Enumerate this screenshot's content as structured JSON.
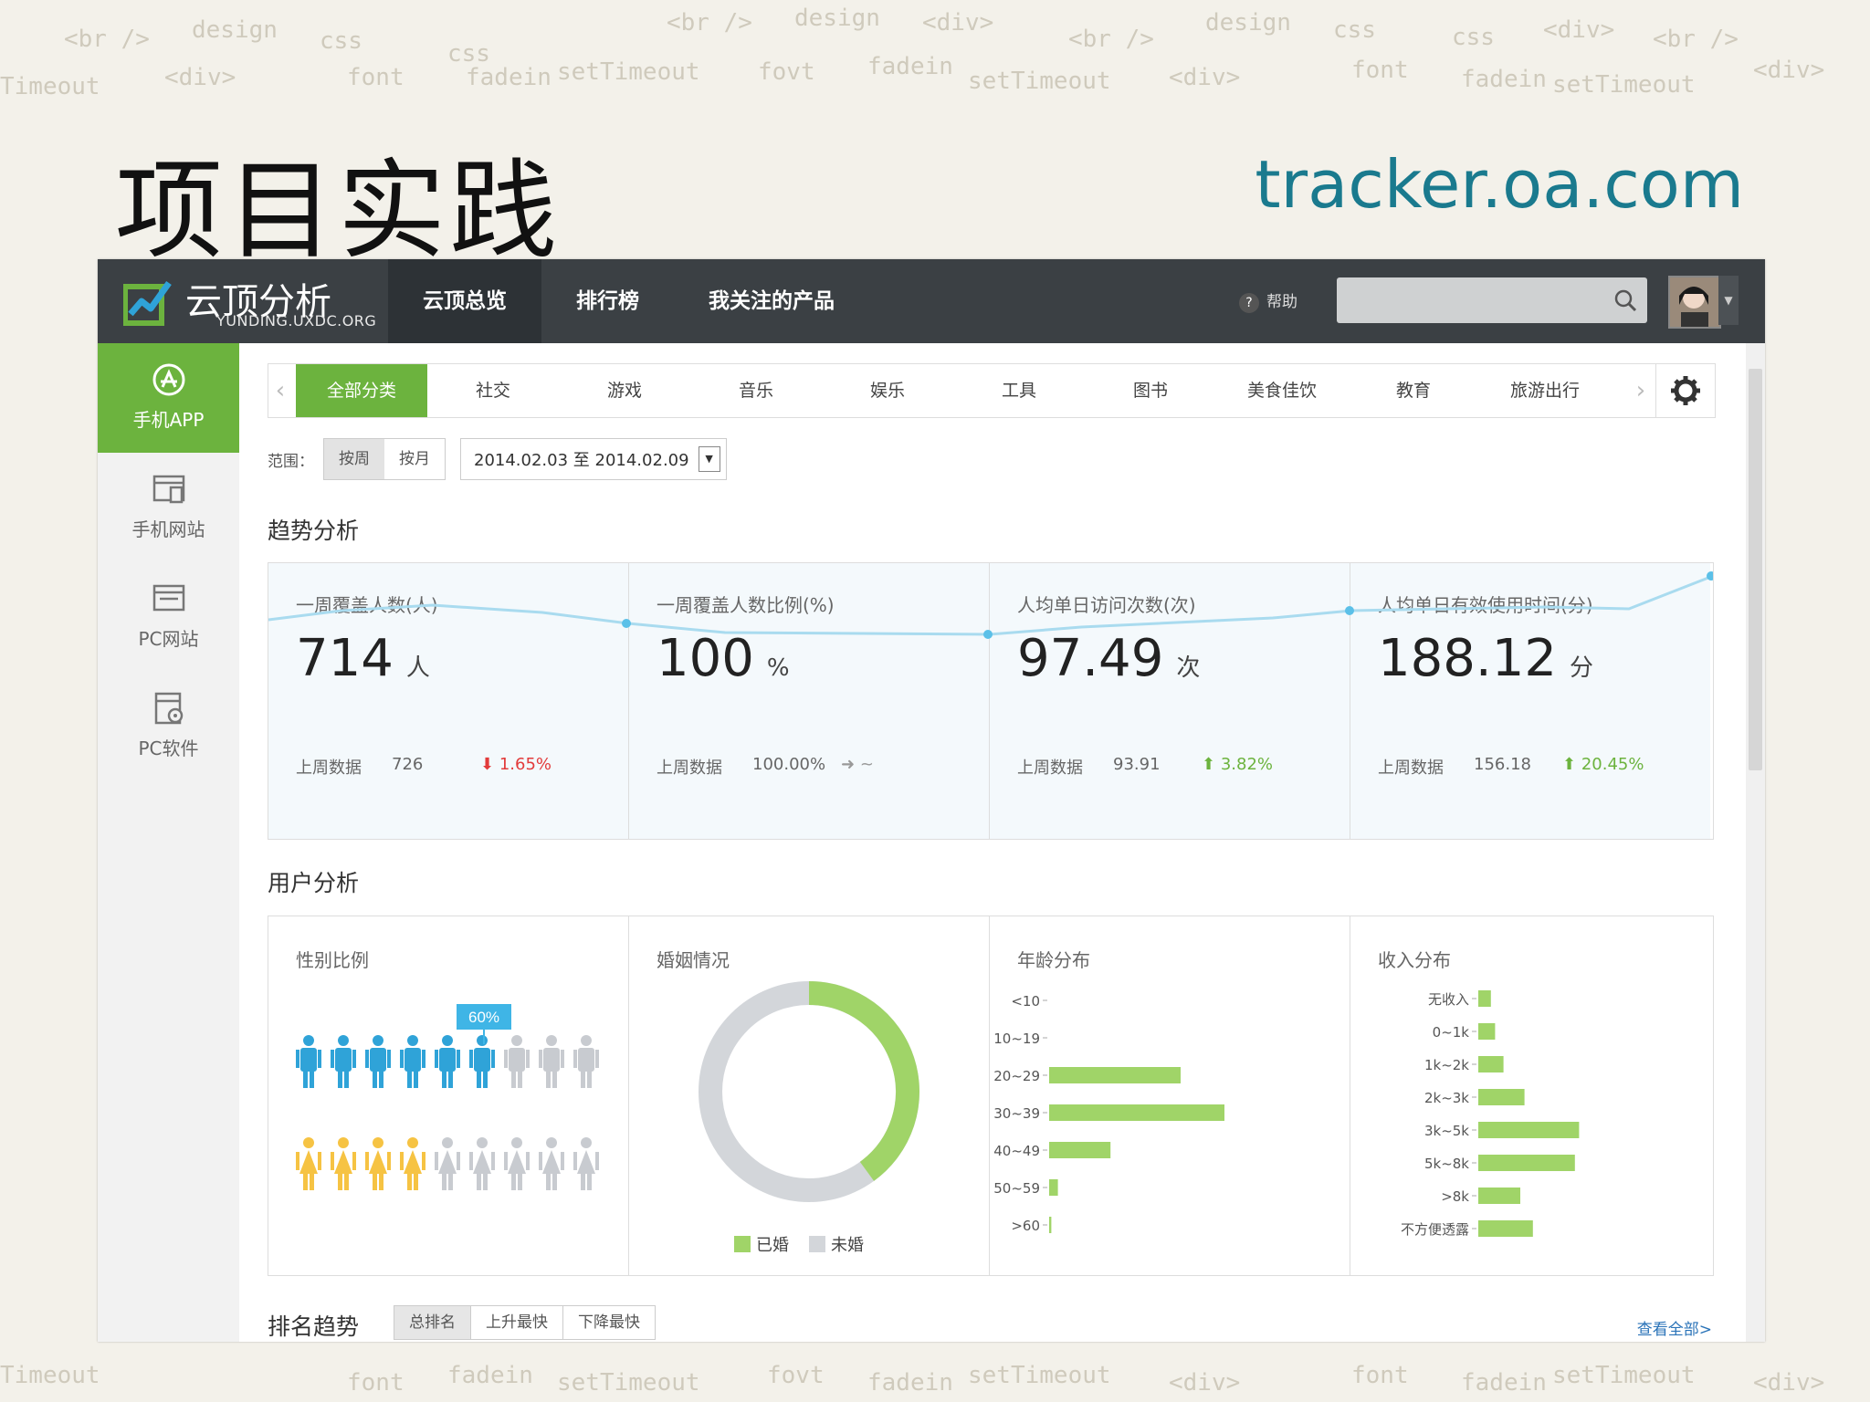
{
  "slide": {
    "title": "项目实践",
    "url": "tracker.oa.com"
  },
  "decor_words": [
    "<br />",
    "design",
    "css",
    "css",
    "<br />",
    "design",
    "<div>",
    "<br />",
    "design",
    "css",
    "css",
    "<div>",
    "<br />",
    "Timeout",
    "<div>",
    "font",
    "fadein",
    "setTimeout",
    "fovt",
    "fadein",
    "setTimeout",
    "<div>",
    "font",
    "fadein",
    "setTimeout",
    "<div>"
  ],
  "app": {
    "logo": {
      "name": "云顶分析",
      "sub": "YUNDING.UXDC.ORG"
    },
    "nav": [
      "云顶总览",
      "排行榜",
      "我关注的产品"
    ],
    "help": "帮助",
    "sidebar": [
      "手机APP",
      "手机网站",
      "PC网站",
      "PC软件"
    ],
    "categories": [
      "全部分类",
      "社交",
      "游戏",
      "音乐",
      "娱乐",
      "工具",
      "图书",
      "美食佳饮",
      "教育",
      "旅游出行"
    ],
    "range": {
      "label": "范围：",
      "options": [
        "按周",
        "按月"
      ],
      "date": "2014.02.03 至 2014.02.09"
    },
    "trend_title": "趋势分析",
    "metrics": [
      {
        "label": "一周覆盖人数(人)",
        "value": "714",
        "unit": "人",
        "prev_label": "上周数据",
        "prev": "726",
        "arrow": "⬇",
        "change": "1.65%",
        "dir": "down"
      },
      {
        "label": "一周覆盖人数比例(%)",
        "value": "100",
        "unit": "%",
        "prev_label": "上周数据",
        "prev": "100.00%",
        "arrow": "➜",
        "change": "~",
        "dir": "flat"
      },
      {
        "label": "人均单日访问次数(次)",
        "value": "97.49",
        "unit": "次",
        "prev_label": "上周数据",
        "prev": "93.91",
        "arrow": "⬆",
        "change": "3.82%",
        "dir": "up"
      },
      {
        "label": "人均单日有效使用时间(分)",
        "value": "188.12",
        "unit": "分",
        "prev_label": "上周数据",
        "prev": "156.18",
        "arrow": "⬆",
        "change": "20.45%",
        "dir": "up"
      }
    ],
    "user_title": "用户分析",
    "panels": {
      "gender": {
        "title": "性别比例",
        "badge": "60%",
        "male_ratio": 0.6
      },
      "marriage": {
        "title": "婚姻情况",
        "married_ratio": 0.4,
        "legend": [
          "已婚",
          "未婚"
        ]
      },
      "age": {
        "title": "年龄分布"
      },
      "income": {
        "title": "收入分布"
      }
    },
    "rank": {
      "title": "排名趋势",
      "tabs": [
        "总排名",
        "上升最快",
        "下降最快"
      ],
      "more": "查看全部>"
    }
  },
  "colors": {
    "green": "#a0d468",
    "brand_green": "#6cb33e",
    "blue": "#2fa3d8",
    "yellow": "#f6c343",
    "gray": "#c8cbd0",
    "topbar": "#3b4044",
    "spark": "#a9dbef"
  },
  "chart_data": [
    {
      "type": "bar",
      "title": "年龄分布",
      "categories": [
        "<10",
        "10~19",
        "20~29",
        "30~39",
        "40~49",
        "50~59",
        ">60"
      ],
      "values": [
        0,
        0,
        30,
        40,
        14,
        2,
        0.5
      ],
      "orientation": "horizontal"
    },
    {
      "type": "bar",
      "title": "收入分布",
      "categories": [
        "无收入",
        "0~1k",
        "1k~2k",
        "2k~3k",
        "3k~5k",
        "5k~8k",
        ">8k",
        "不方便透露"
      ],
      "values": [
        3,
        4,
        6,
        11,
        24,
        23,
        10,
        13
      ],
      "orientation": "horizontal"
    },
    {
      "type": "pie",
      "title": "婚姻情况",
      "categories": [
        "已婚",
        "未婚"
      ],
      "values": [
        40,
        60
      ]
    }
  ]
}
